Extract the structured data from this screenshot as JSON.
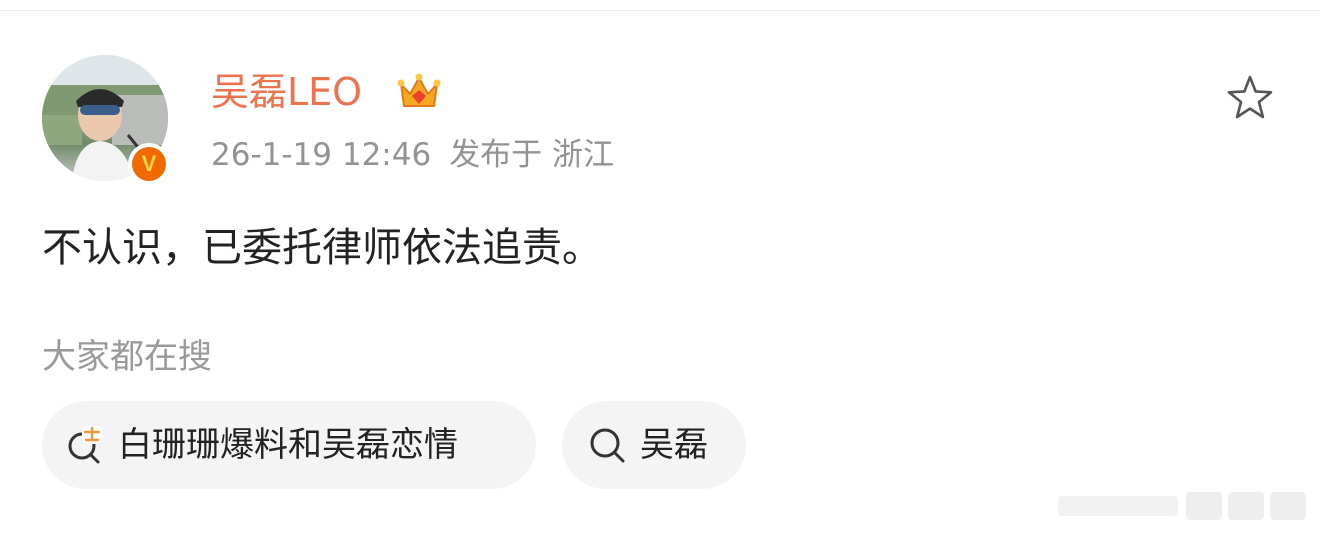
{
  "post": {
    "username": "吴磊LEO",
    "timestamp": "26-1-19 12:46",
    "location": "发布于 浙江",
    "text": "不认识，已委托律师依法追责。"
  },
  "search_section": {
    "label": "大家都在搜",
    "chips": [
      {
        "label": "白珊珊爆料和吴磊恋情",
        "icon": "hot-search-icon"
      },
      {
        "label": "吴磊",
        "icon": "search-icon"
      }
    ]
  },
  "icons": {
    "favorite": "star-icon",
    "badge": "verified-v-icon",
    "membership": "crown-icon"
  },
  "colors": {
    "username": "#eb7350",
    "meta": "#939393",
    "chip_bg": "#f4f4f4",
    "badge": "#f06a00"
  }
}
